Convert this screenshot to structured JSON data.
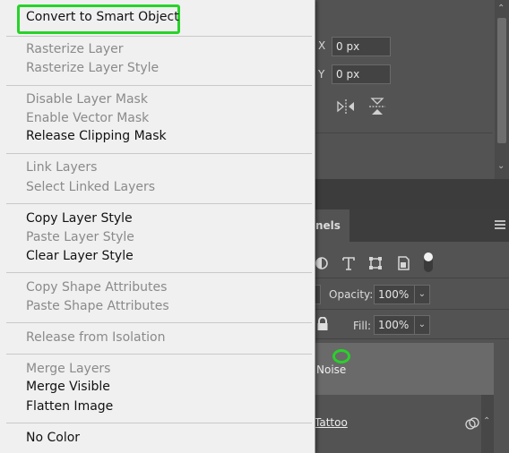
{
  "context_menu": {
    "items": [
      {
        "label": "Convert to Smart Object",
        "enabled": true,
        "highlighted": true
      },
      {
        "label": "Rasterize Layer",
        "enabled": false
      },
      {
        "label": "Rasterize Layer Style",
        "enabled": false
      },
      {
        "label": "Disable Layer Mask",
        "enabled": false
      },
      {
        "label": "Enable Vector Mask",
        "enabled": false
      },
      {
        "label": "Release Clipping Mask",
        "enabled": true
      },
      {
        "label": "Link Layers",
        "enabled": false
      },
      {
        "label": "Select Linked Layers",
        "enabled": false
      },
      {
        "label": "Copy Layer Style",
        "enabled": true
      },
      {
        "label": "Paste Layer Style",
        "enabled": false
      },
      {
        "label": "Clear Layer Style",
        "enabled": true
      },
      {
        "label": "Copy Shape Attributes",
        "enabled": false
      },
      {
        "label": "Paste Shape Attributes",
        "enabled": false
      },
      {
        "label": "Release from Isolation",
        "enabled": false
      },
      {
        "label": "Merge Layers",
        "enabled": false
      },
      {
        "label": "Merge Visible",
        "enabled": true
      },
      {
        "label": "Flatten Image",
        "enabled": true
      },
      {
        "label": "No Color",
        "enabled": true
      }
    ],
    "highlight_color": "#27d32a"
  },
  "properties": {
    "x_label": "X",
    "x_value": "0 px",
    "y_label": "Y",
    "y_value": "0 px",
    "icons": [
      "flip-horizontal-icon",
      "flip-vertical-icon"
    ]
  },
  "layers_panel": {
    "tab_label": "nels",
    "filter_icons": [
      "adjustment-filter-icon",
      "type-filter-icon",
      "shape-filter-icon",
      "smart-object-filter-icon",
      "filter-toggle-icon"
    ],
    "opacity_label": "Opacity:",
    "opacity_value": "100%",
    "fill_label": "Fill:",
    "fill_value": "100%",
    "layers": [
      {
        "name": "Noise",
        "selected": true
      },
      {
        "name": "Tattoo",
        "selected": false
      }
    ]
  }
}
